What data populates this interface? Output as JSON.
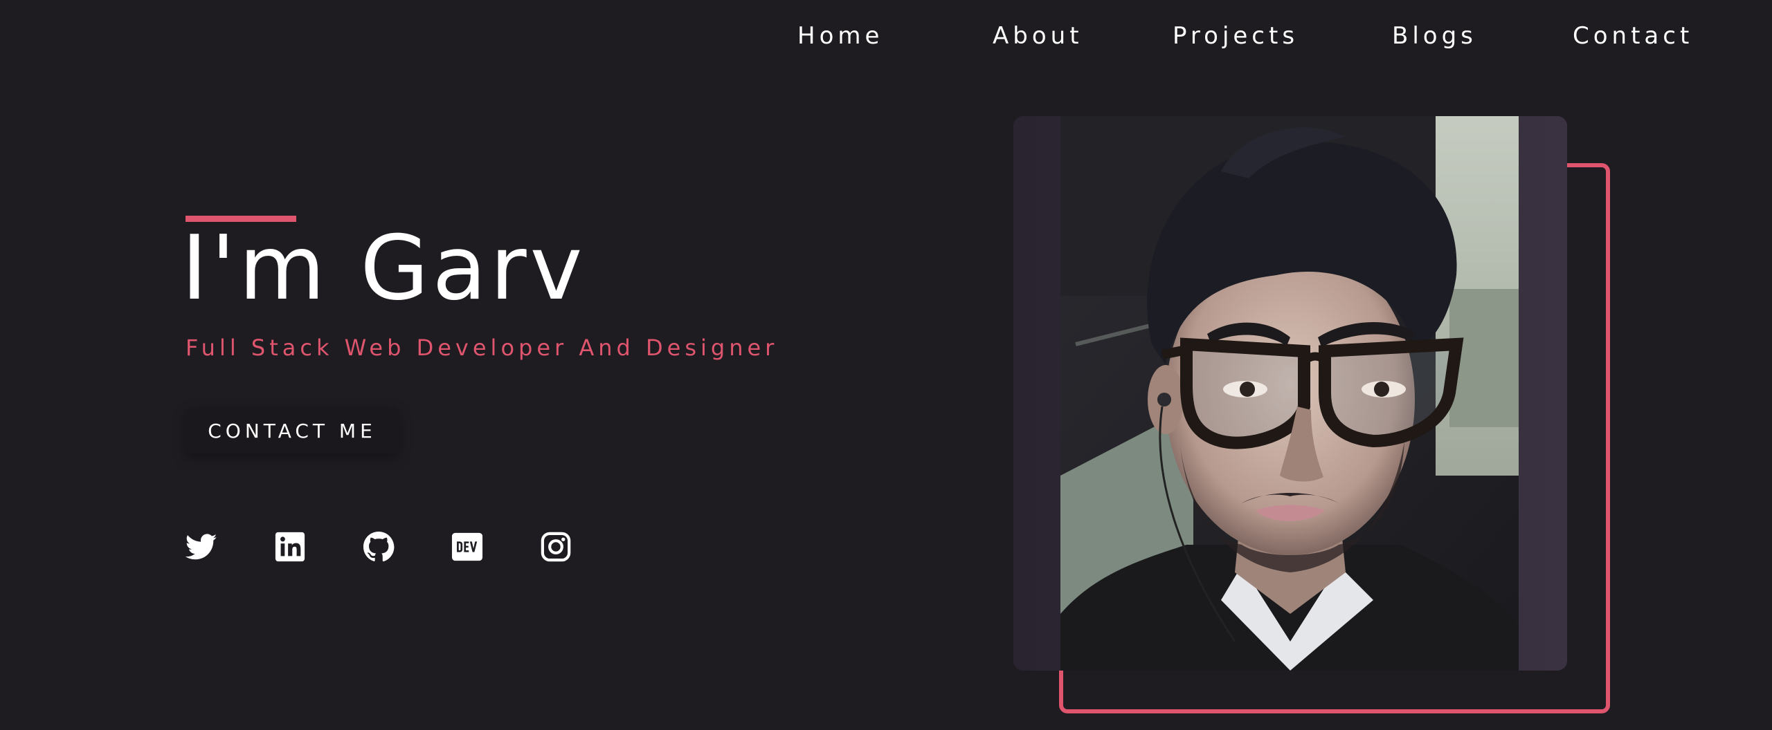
{
  "nav": {
    "items": [
      {
        "label": "Home"
      },
      {
        "label": "About"
      },
      {
        "label": "Projects"
      },
      {
        "label": "Blogs"
      },
      {
        "label": "Contact"
      }
    ]
  },
  "hero": {
    "title": "I'm Garv",
    "subtitle": "Full Stack Web Developer And Designer",
    "cta_label": "CONTACT ME"
  },
  "socials": [
    {
      "icon": "twitter-icon"
    },
    {
      "icon": "linkedin-icon"
    },
    {
      "icon": "github-icon"
    },
    {
      "icon": "dev-icon",
      "text": "DEV"
    },
    {
      "icon": "instagram-icon"
    }
  ],
  "colors": {
    "background": "#1e1c21",
    "accent": "#e0556e",
    "text": "#ffffff"
  },
  "photo": {
    "icon": "profile-photo"
  }
}
